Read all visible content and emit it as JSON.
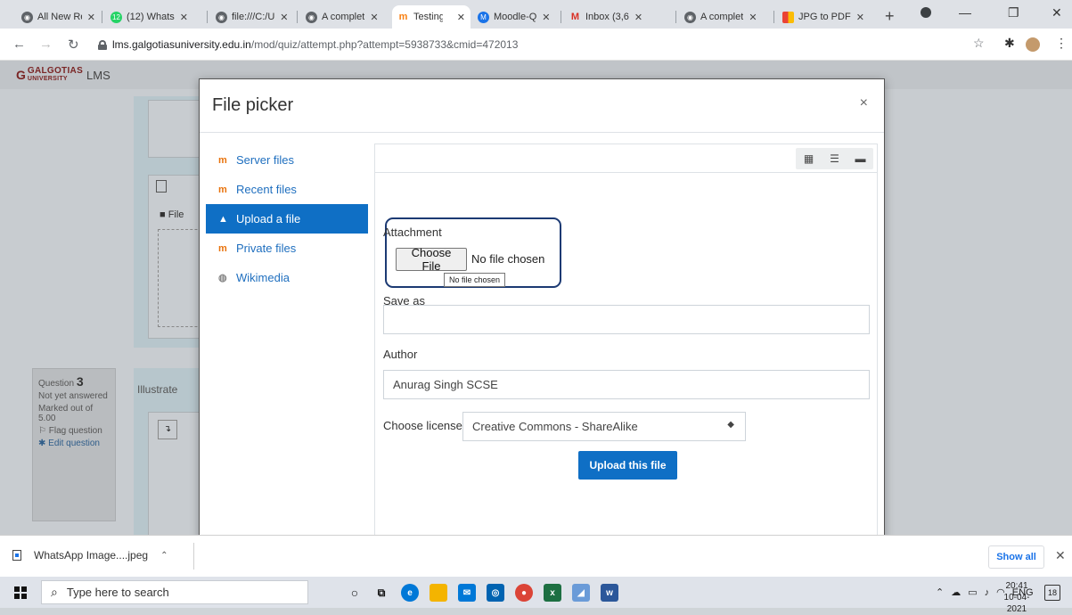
{
  "browser": {
    "tabs": [
      {
        "label": "All New Re",
        "fav_color": "#5f6368",
        "active": false
      },
      {
        "label": "(12) Whats",
        "fav_color": "#25d366",
        "active": false
      },
      {
        "label": "file:///C:/U",
        "fav_color": "#5f6368",
        "active": false
      },
      {
        "label": "A complet",
        "fav_color": "#5f6368",
        "active": false
      },
      {
        "label": "Testing",
        "fav_color": "#f98012",
        "active": true
      },
      {
        "label": "Moodle-Q",
        "fav_color": "#1a73e8",
        "active": false
      },
      {
        "label": "Inbox (3,6",
        "fav_color": "#d93025",
        "active": false
      },
      {
        "label": "A complet",
        "fav_color": "#5f6368",
        "active": false
      },
      {
        "label": "JPG to PDF",
        "fav_color": "#f4b400",
        "active": false
      }
    ],
    "url_host": "lms.galgotiasuniversity.edu.in",
    "url_path": "/mod/quiz/attempt.php?attempt=5938733&cmid=472013"
  },
  "page": {
    "logo_text": "GALGOTIAS",
    "logo_sub": "UNIVERSITY",
    "logo_lms": "LMS",
    "question": {
      "label": "Question",
      "number": "3",
      "status": "Not yet answered",
      "marks": "Marked out of 5.00",
      "flag": "Flag question",
      "edit": "Edit question"
    },
    "illustrate": "Illustrate",
    "files_label": "File"
  },
  "modal": {
    "title": "File picker",
    "close": "×",
    "nav": [
      {
        "label": "Server files",
        "icon": "moodle-icon"
      },
      {
        "label": "Recent files",
        "icon": "moodle-icon"
      },
      {
        "label": "Upload a file",
        "icon": "upload-icon"
      },
      {
        "label": "Private files",
        "icon": "moodle-icon"
      },
      {
        "label": "Wikimedia",
        "icon": "wikimedia-icon"
      }
    ],
    "attachment_label": "Attachment",
    "choose_file": "Choose File",
    "no_file": "No file chosen",
    "tooltip": "No file chosen",
    "save_as_label": "Save as",
    "save_as_value": "",
    "author_label": "Author",
    "author_value": "Anurag Singh SCSE",
    "license_label": "Choose license",
    "license_value": "Creative Commons - ShareAlike",
    "upload_button": "Upload this file"
  },
  "downloads": {
    "file": "WhatsApp Image....jpeg",
    "show_all": "Show all"
  },
  "taskbar": {
    "search_placeholder": "Type here to search",
    "lang": "ENG",
    "time": "20:41",
    "date": "10-04-2021",
    "notif_count": "18"
  }
}
